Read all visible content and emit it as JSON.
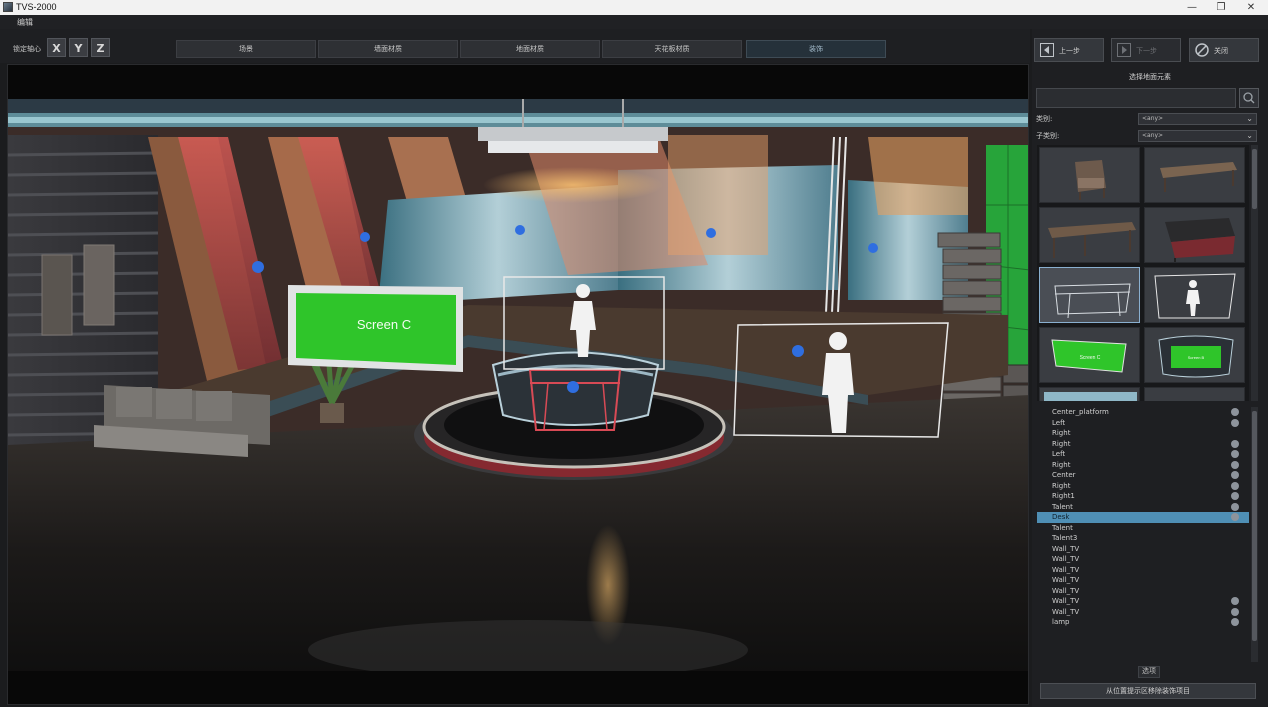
{
  "window": {
    "title": "TVS-2000",
    "minimize": "—",
    "restore": "❐",
    "close": "✕"
  },
  "menu": {
    "edit": "编辑"
  },
  "toolbar": {
    "lock_axis_label": "锁定轴心",
    "axes": [
      "X",
      "Y",
      "Z"
    ],
    "tabs": [
      "场景",
      "墙面材质",
      "地面材质",
      "天花板材质",
      "装饰"
    ],
    "active_tab": "装饰"
  },
  "viewport": {
    "screen_label": "Screen C",
    "thumb_screen_label": "Screen C",
    "thumb_screen_label_2": "Screen B"
  },
  "nav": {
    "prev": "上一步",
    "next": "下一步",
    "close": "关闭"
  },
  "panel": {
    "title": "选择地面元素",
    "search_placeholder": "",
    "category_label": "类别:",
    "category_value": "<any>",
    "subcategory_label": "子类别:",
    "subcategory_value": "<any>"
  },
  "thumbnails": [
    "armchair",
    "long-table",
    "wooden-table",
    "red-desk",
    "glass-desk",
    "talent-placeholder",
    "screen-c",
    "anchor-desk-screen",
    "studio-element",
    "studio-element"
  ],
  "items": [
    {
      "name": "Center_platform",
      "dot": true
    },
    {
      "name": "Left",
      "dot": true
    },
    {
      "name": "Right",
      "dot": false
    },
    {
      "name": "Right",
      "dot": true
    },
    {
      "name": "Left",
      "dot": true
    },
    {
      "name": "Right",
      "dot": true
    },
    {
      "name": "Center",
      "dot": true
    },
    {
      "name": "Right",
      "dot": true
    },
    {
      "name": "Right1",
      "dot": true
    },
    {
      "name": "Talent",
      "dot": true
    },
    {
      "name": "Desk",
      "dot": true,
      "selected": true
    },
    {
      "name": "Talent",
      "dot": false
    },
    {
      "name": "Talent3",
      "dot": false
    },
    {
      "name": "Wall_TV",
      "dot": false
    },
    {
      "name": "Wall_TV",
      "dot": false
    },
    {
      "name": "Wall_TV",
      "dot": false
    },
    {
      "name": "Wall_TV",
      "dot": false
    },
    {
      "name": "Wall_TV",
      "dot": false
    },
    {
      "name": "Wall_TV",
      "dot": true
    },
    {
      "name": "Wall_TV",
      "dot": true
    },
    {
      "name": "lamp",
      "dot": true
    }
  ],
  "options_label": "选项",
  "remove_button": "从位置提示区移除装饰项目",
  "colors": {
    "accent": "#4f8fb5",
    "green_screen": "#2fc52a",
    "background": "#1b1c1e"
  }
}
